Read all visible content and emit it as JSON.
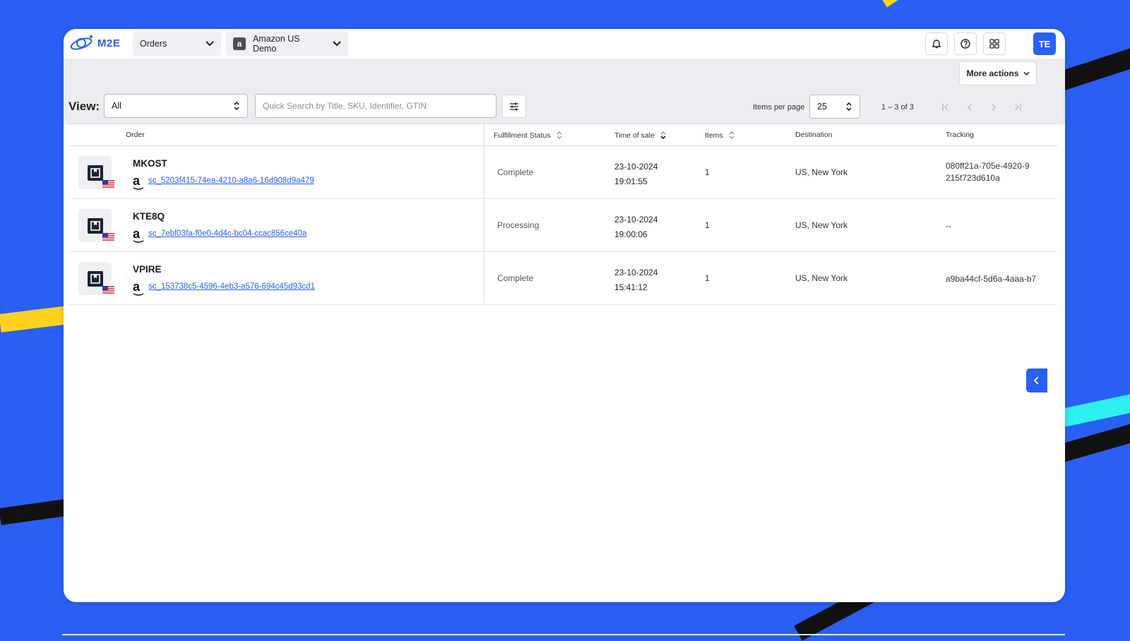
{
  "app": {
    "logo_text": "M2E"
  },
  "header": {
    "section_dropdown": "Orders",
    "account_icon_letter": "a",
    "account_dropdown": "Amazon US Demo",
    "avatar_initials": "TE"
  },
  "toolbar": {
    "more_actions_label": "More actions",
    "view_label": "View:",
    "view_value": "All",
    "search_placeholder": "Quick Search by Title, SKU, Identifier, GTIN",
    "items_per_page_label": "Items per page",
    "items_per_page_value": "25",
    "range_text": "1 – 3 of 3"
  },
  "table": {
    "headers": {
      "order": "Order",
      "fulfillment": "Fulfillment Status",
      "time": "Time of sale",
      "items": "Items",
      "destination": "Destination",
      "tracking": "Tracking"
    },
    "rows": [
      {
        "order_id": "MKOST",
        "marketplace_letter": "a",
        "link": "sc_5203f415-74ea-4210-a8a6-16d908d9a479",
        "status": "Complete",
        "date": "23-10-2024",
        "time": "19:01:55",
        "items": "1",
        "destination": "US, New York",
        "tracking": "080ff21a-705e-4920-9\n215f723d610a"
      },
      {
        "order_id": "KTE8Q",
        "marketplace_letter": "a",
        "link": "sc_7ebf03fa-f0e0-4d4c-bc04-ccac856ce40a",
        "status": "Processing",
        "date": "23-10-2024",
        "time": "19:00:06",
        "items": "1",
        "destination": "US, New York",
        "tracking": "--"
      },
      {
        "order_id": "VPIRE",
        "marketplace_letter": "a",
        "link": "sc_153738c5-4596-4eb3-a576-694c45d93cd1",
        "status": "Complete",
        "date": "23-10-2024",
        "time": "15:41:12",
        "items": "1",
        "destination": "US, New York",
        "tracking": "a9ba44cf-5d6a-4aaa-b7"
      }
    ]
  },
  "colors": {
    "brand": "#2a5ff5",
    "background": "#2a5ff5",
    "accent_yellow": "#ffd21f",
    "accent_cyan": "#2ff0ef"
  }
}
